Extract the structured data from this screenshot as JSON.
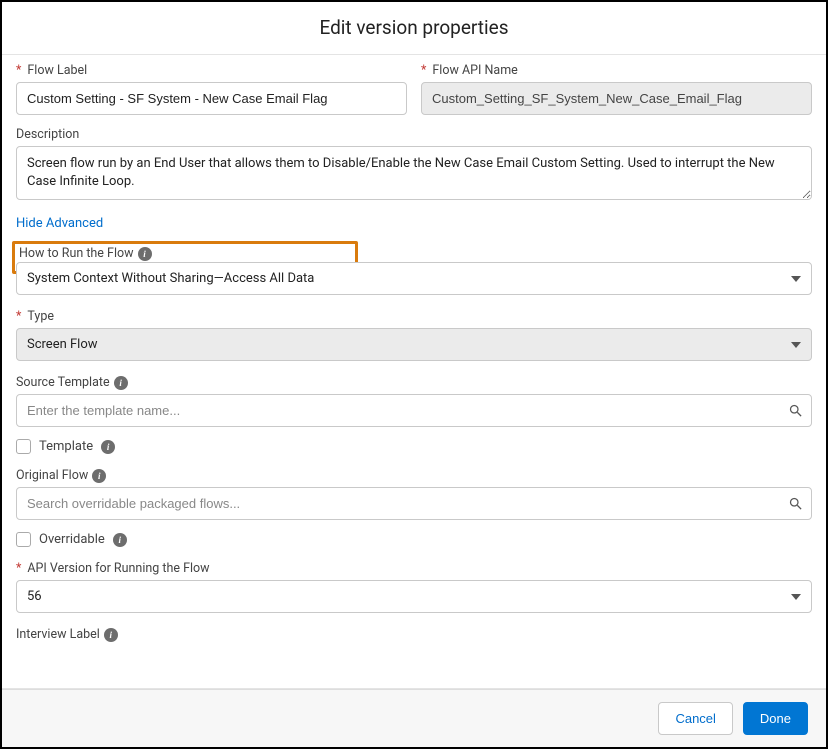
{
  "title": "Edit version properties",
  "labels": {
    "flow_label": "Flow Label",
    "flow_api_name": "Flow API Name",
    "description": "Description",
    "hide_advanced": "Hide Advanced",
    "how_to_run": "How to Run the Flow",
    "type": "Type",
    "source_template": "Source Template",
    "template_cb": "Template",
    "original_flow": "Original Flow",
    "overridable_cb": "Overridable",
    "api_version": "API Version for Running the Flow",
    "interview_label": "Interview Label"
  },
  "values": {
    "flow_label": "Custom Setting - SF System - New Case Email Flag",
    "flow_api_name": "Custom_Setting_SF_System_New_Case_Email_Flag",
    "description": "Screen flow run by an End User that allows them to Disable/Enable the New Case Email Custom Setting. Used to interrupt the New Case Infinite Loop.",
    "how_to_run": "System Context Without Sharing—Access All Data",
    "type": "Screen Flow",
    "api_version": "56"
  },
  "placeholders": {
    "source_template": "Enter the template name...",
    "original_flow": "Search overridable packaged flows..."
  },
  "footer": {
    "cancel": "Cancel",
    "done": "Done"
  }
}
